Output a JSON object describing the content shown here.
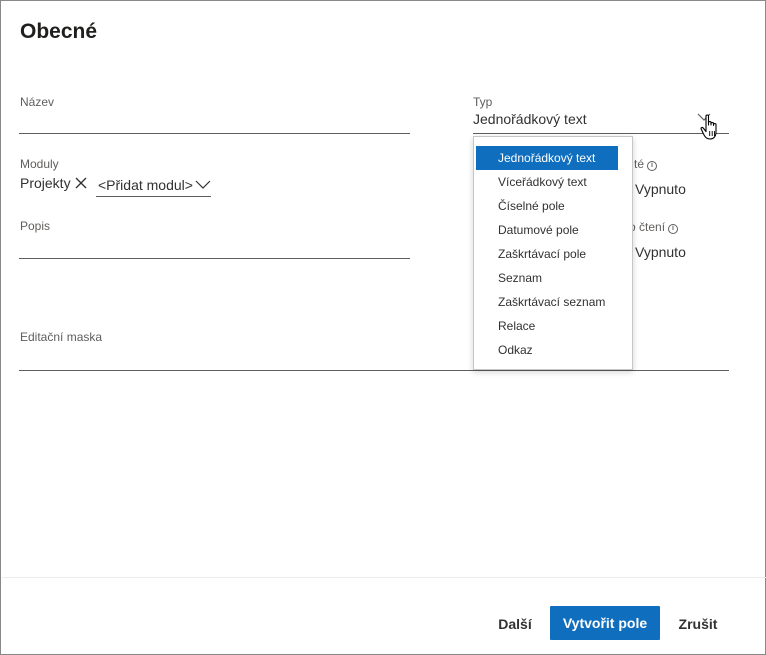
{
  "dialog": {
    "title": "Obecné"
  },
  "fields": {
    "name": {
      "label": "Název",
      "value": ""
    },
    "type": {
      "label": "Typ",
      "value": "Jednořádkový text"
    },
    "modules": {
      "label": "Moduly",
      "tags": [
        "Projekty"
      ],
      "add_placeholder": "<Přidat modul>"
    },
    "description": {
      "label": "Popis",
      "value": ""
    },
    "edit_mask": {
      "label": "Editační maska",
      "value": ""
    },
    "required": {
      "label_partial": "té",
      "value": "Vypnuto"
    },
    "readonly": {
      "label_partial": "o čtení",
      "value": "Vypnuto"
    }
  },
  "type_dropdown": {
    "selected": "Jednořádkový text",
    "options": [
      "Jednořádkový text",
      "Víceřádkový text",
      "Číselné pole",
      "Datumové pole",
      "Zaškrtávací pole",
      "Seznam",
      "Zaškrtávací seznam",
      "Relace",
      "Odkaz"
    ]
  },
  "footer": {
    "next_label": "Další",
    "create_label": "Vytvořit pole",
    "cancel_label": "Zrušit"
  },
  "colors": {
    "primary": "#106ebe",
    "text": "#323130",
    "label": "#605e5c",
    "border": "#8a8886"
  },
  "icons": {
    "tag_remove": "close-icon",
    "add_module_chevron": "chevron-down-icon",
    "type_chevron": "chevron-down-icon",
    "info": "info-icon",
    "cursor": "hand-pointer-icon"
  }
}
